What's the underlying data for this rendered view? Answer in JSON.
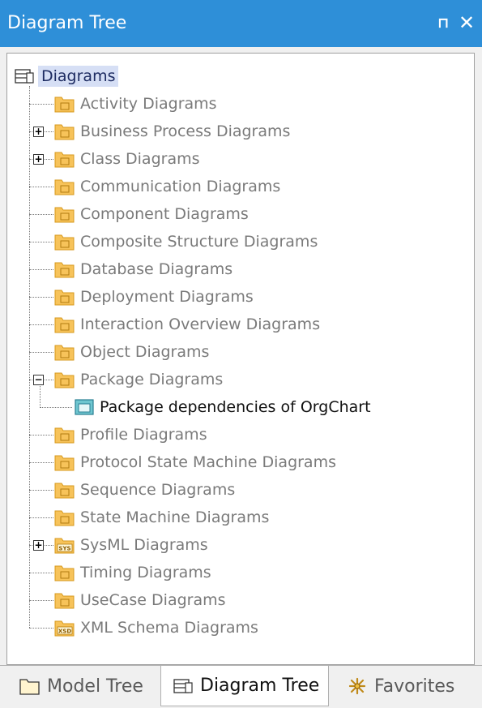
{
  "window": {
    "title": "Diagram Tree",
    "pin_icon": "pin-icon",
    "close_icon": "close-icon"
  },
  "tree": {
    "root": "Diagrams",
    "items": [
      {
        "label": "Activity Diagrams",
        "expander": "none",
        "icon": "activity-diagram-folder-icon"
      },
      {
        "label": "Business Process Diagrams",
        "expander": "plus",
        "icon": "business-process-folder-icon"
      },
      {
        "label": "Class Diagrams",
        "expander": "plus",
        "icon": "class-diagram-folder-icon"
      },
      {
        "label": "Communication Diagrams",
        "expander": "none",
        "icon": "communication-diagram-folder-icon"
      },
      {
        "label": "Component Diagrams",
        "expander": "none",
        "icon": "component-diagram-folder-icon"
      },
      {
        "label": "Composite Structure Diagrams",
        "expander": "none",
        "icon": "composite-structure-folder-icon"
      },
      {
        "label": "Database Diagrams",
        "expander": "none",
        "icon": "database-diagram-folder-icon"
      },
      {
        "label": "Deployment Diagrams",
        "expander": "none",
        "icon": "deployment-diagram-folder-icon"
      },
      {
        "label": "Interaction Overview Diagrams",
        "expander": "none",
        "icon": "interaction-overview-folder-icon"
      },
      {
        "label": "Object Diagrams",
        "expander": "none",
        "icon": "object-diagram-folder-icon"
      },
      {
        "label": "Package Diagrams",
        "expander": "minus",
        "icon": "package-diagram-folder-icon",
        "children": [
          {
            "label": "Package dependencies of OrgChart",
            "icon": "package-diagram-icon"
          }
        ]
      },
      {
        "label": "Profile Diagrams",
        "expander": "none",
        "icon": "profile-diagram-folder-icon"
      },
      {
        "label": "Protocol State Machine Diagrams",
        "expander": "none",
        "icon": "protocol-state-machine-folder-icon"
      },
      {
        "label": "Sequence Diagrams",
        "expander": "none",
        "icon": "sequence-diagram-folder-icon"
      },
      {
        "label": "State Machine Diagrams",
        "expander": "none",
        "icon": "state-machine-folder-icon"
      },
      {
        "label": "SysML Diagrams",
        "expander": "plus",
        "icon": "sysml-diagram-folder-icon",
        "badge": "SYS"
      },
      {
        "label": "Timing Diagrams",
        "expander": "none",
        "icon": "timing-diagram-folder-icon"
      },
      {
        "label": "UseCase Diagrams",
        "expander": "none",
        "icon": "usecase-diagram-folder-icon"
      },
      {
        "label": "XML Schema Diagrams",
        "expander": "none",
        "icon": "xml-schema-folder-icon",
        "badge": "XSD"
      }
    ]
  },
  "tabs": [
    {
      "label": "Model Tree",
      "icon": "folder-icon",
      "active": false
    },
    {
      "label": "Diagram Tree",
      "icon": "diagram-tree-icon",
      "active": true
    },
    {
      "label": "Favorites",
      "icon": "favorites-icon",
      "active": false
    }
  ],
  "colors": {
    "titlebar": "#2e8fd8",
    "folder": "#f7c35a",
    "folder_border": "#d79a1e",
    "root_highlight": "#d6dff5"
  }
}
